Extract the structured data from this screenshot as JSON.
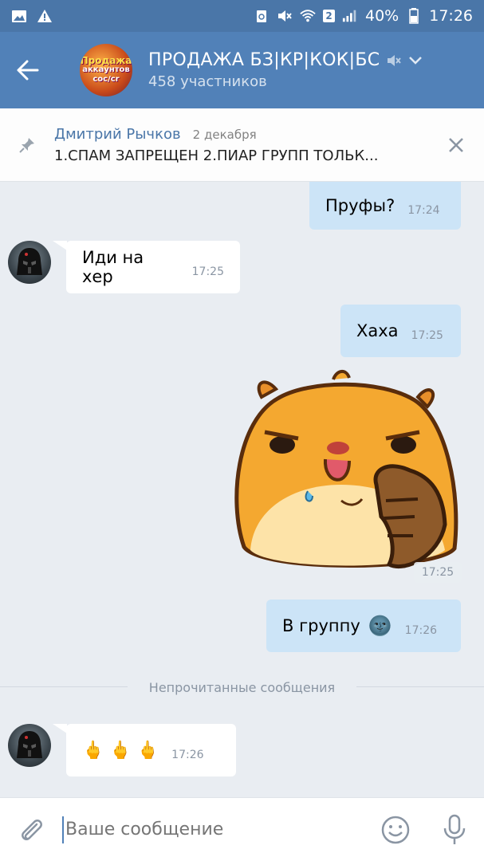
{
  "status_bar": {
    "sim_badge": "2",
    "battery": "40%",
    "time": "17:26",
    "left_icons": [
      "image-icon",
      "warning-icon"
    ],
    "right_icons": [
      "recycle-icon",
      "mute-icon",
      "wifi-icon",
      "signal-icon",
      "battery-icon"
    ]
  },
  "toolbar": {
    "title": "ПРОДАЖА БЗ|КР|КОК|БС",
    "subtitle": "458 участников",
    "avatar_text": [
      "Продажа",
      "аккаунтов",
      "coc/cr"
    ],
    "accent": "#5181b8"
  },
  "pinned": {
    "author": "Дмитрий Рычков",
    "date": "2 декабря",
    "text": "1.СПАМ ЗАПРЕЩЕН  2.ПИАР ГРУПП ТОЛЬК..."
  },
  "messages": [
    {
      "direction": "out",
      "text": "Пруфы?",
      "time": "17:24"
    },
    {
      "direction": "in",
      "text": "Иди на хер",
      "time": "17:25"
    },
    {
      "direction": "out",
      "text": "Хаха",
      "time": "17:25"
    },
    {
      "direction": "out",
      "type": "sticker",
      "time": "17:25"
    },
    {
      "direction": "out",
      "text": "В группу",
      "emoji": "🌚",
      "time": "17:26"
    },
    {
      "direction": "in",
      "text": "🖕 🖕 🖕",
      "time": "17:26"
    }
  ],
  "divider": {
    "label": "Непрочитанные сообщения"
  },
  "input": {
    "placeholder": "Ваше сообщение"
  },
  "colors": {
    "header": "#5181b8",
    "status": "#4a76a8",
    "outgoing": "#cce4f7",
    "incoming": "#ffffff",
    "background": "#e9edf2"
  }
}
